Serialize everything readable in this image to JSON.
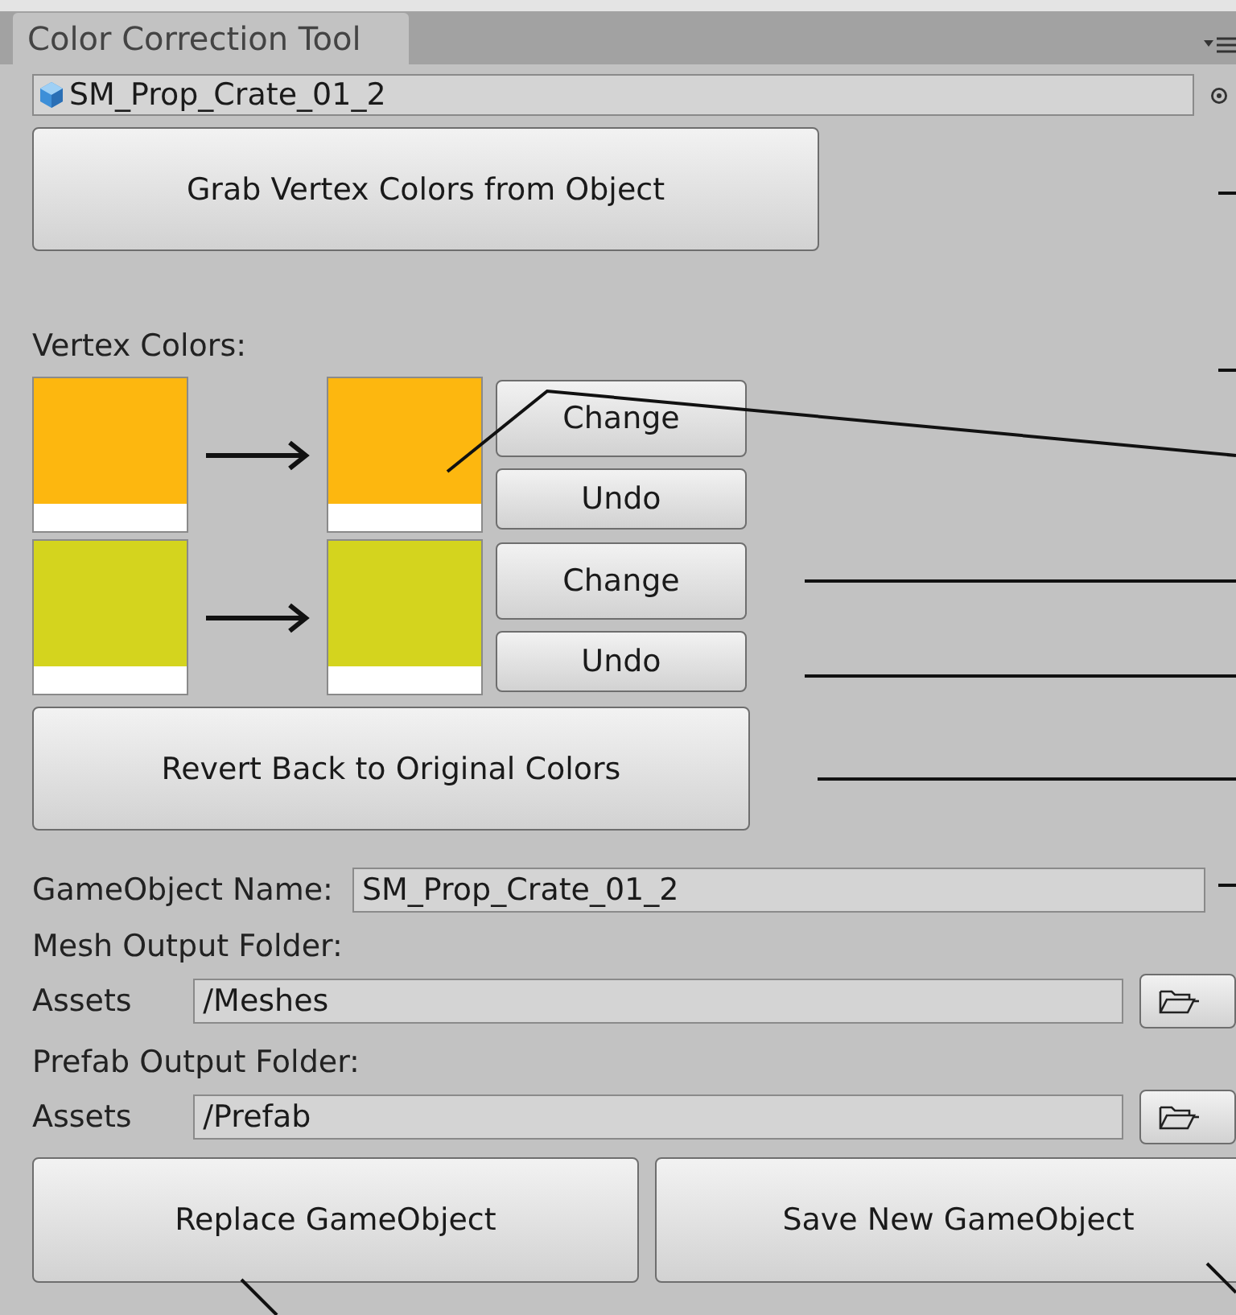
{
  "tab": {
    "label": "Color Correction Tool",
    "selected": true
  },
  "object_field": {
    "value": "SM_Prop_Crate_01_2"
  },
  "grab_button": "Grab Vertex Colors from Object",
  "vertex_colors": {
    "label": "Vertex Colors:",
    "rows": [
      {
        "from": {
          "color": "#fdb70f"
        },
        "to": {
          "color": "#fdb70f"
        },
        "change_button": "Change",
        "undo_button": "Undo"
      },
      {
        "from": {
          "color": "#d4d41e"
        },
        "to": {
          "color": "#d4d41e"
        },
        "change_button": "Change",
        "undo_button": "Undo"
      }
    ]
  },
  "revert_button": "Revert Back to Original Colors",
  "gameobject_name": {
    "label": "GameObject Name:",
    "value": "SM_Prop_Crate_01_2"
  },
  "folders": [
    {
      "label": "Mesh Output Folder:",
      "prefix": "Assets",
      "value": "/Meshes"
    },
    {
      "label": "Prefab Output Folder:",
      "prefix": "Assets",
      "value": "/Prefab"
    }
  ],
  "actions": [
    "Replace GameObject",
    "Save New GameObject"
  ]
}
